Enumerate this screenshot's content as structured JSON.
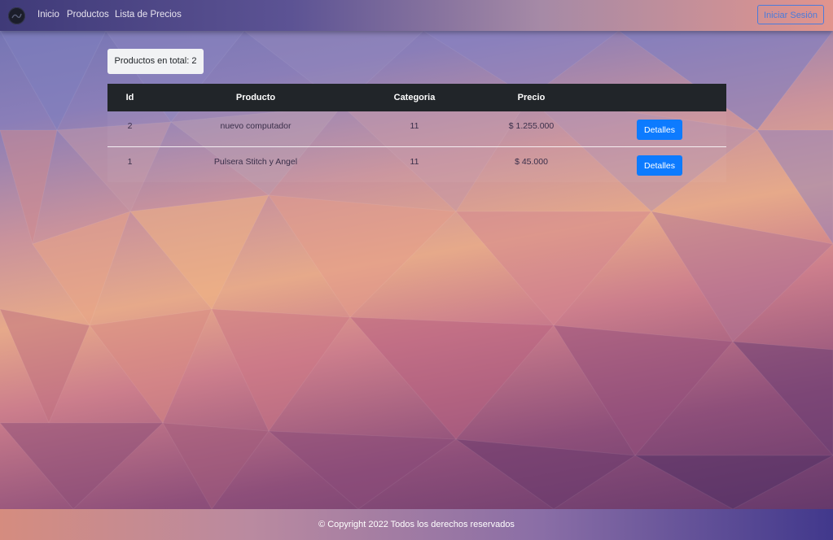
{
  "navbar": {
    "logo_icon": "brand-logo-icon",
    "links": [
      "Inicio",
      "Productos",
      "Lista de Precios"
    ],
    "login_label": "Iniciar Sesión"
  },
  "summary": {
    "total_label": "Productos en total: 2"
  },
  "table": {
    "headers": [
      "Id",
      "Producto",
      "Categoria",
      "Precio",
      ""
    ],
    "rows": [
      {
        "id": "2",
        "producto": "nuevo computador",
        "categoria": "11",
        "precio": "$ 1.255.000",
        "action": "Detalles"
      },
      {
        "id": "1",
        "producto": "Pulsera Stitch y Angel",
        "categoria": "11",
        "precio": "$ 45.000",
        "action": "Detalles"
      }
    ]
  },
  "footer": {
    "text": "© Copyright 2022 Todos los derechos reservados"
  },
  "colors": {
    "primary_button": "#0d7bff",
    "table_header": "#212529",
    "login_outline": "#4a7bdc"
  }
}
